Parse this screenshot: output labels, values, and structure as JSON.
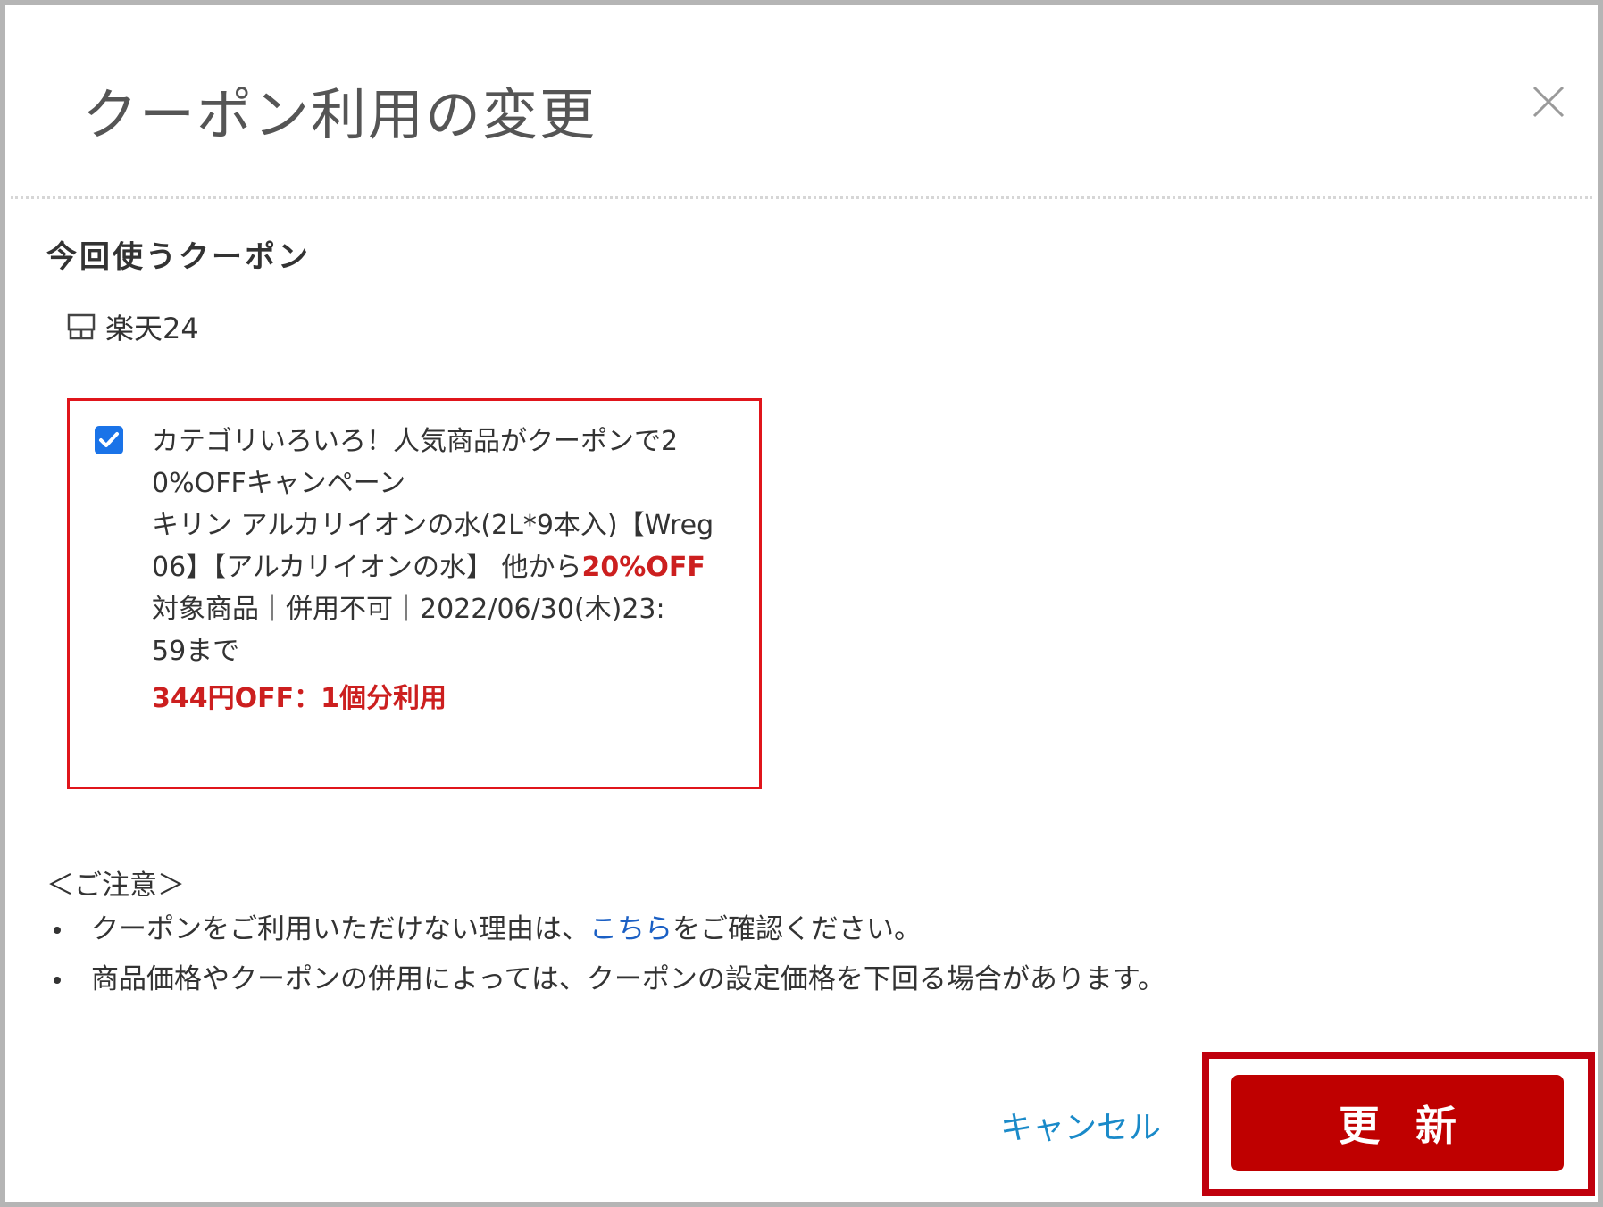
{
  "dialog": {
    "title": "クーポン利用の変更",
    "close_icon": "close-icon"
  },
  "section": {
    "title": "今回使うクーポン"
  },
  "shop": {
    "icon": "shop-icon",
    "name": "楽天24"
  },
  "coupon": {
    "checked": true,
    "title_line1": "カテゴリいろいろ！人気商品がクーポンで2",
    "title_line2": "0%OFFキャンペーン",
    "product_line1": "キリン アルカリイオンの水(2L*9本入)【Wreg",
    "product_line2_prefix": "06】【アルカリイオンの水】 他から",
    "product_line2_discount": "20%OFF",
    "terms_line1": "対象商品｜併用不可｜2022/06/30(木)23:",
    "terms_line2": "59まで",
    "discount_usage": "344円OFF：1個分利用"
  },
  "notes": {
    "title": "＜ご注意＞",
    "item1_prefix": "クーポンをご利用いただけない理由は、",
    "item1_link": "こちら",
    "item1_suffix": "をご確認ください。",
    "item2": "商品価格やクーポンの併用によっては、クーポンの設定価格を下回る場合があります。"
  },
  "actions": {
    "cancel_label": "キャンセル",
    "update_label": "更新"
  },
  "colors": {
    "accent_red": "#bf0000",
    "highlight_red": "#e0151b",
    "link_blue": "#1a5fc4",
    "checkbox_blue": "#1a73e8"
  }
}
